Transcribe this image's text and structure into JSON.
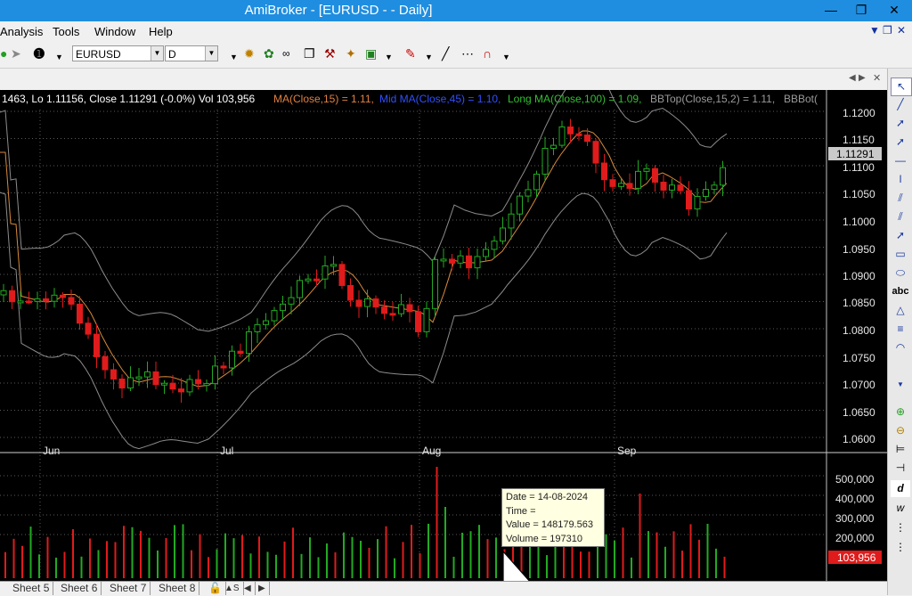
{
  "window": {
    "title": "AmiBroker - [EURUSD -  - Daily]"
  },
  "menu": [
    "Analysis",
    "Tools",
    "Window",
    "Help"
  ],
  "toolbar": {
    "symbol": "EURUSD",
    "interval": "D"
  },
  "legend": {
    "prefix": "1463, Lo 1.11156, Close 1.11291 (-0.0%) Vol 103,956",
    "ma15": "MA(Close,15) = 1.11,",
    "ma45": "Mid MA(Close,45) = 1.10,",
    "ma100": "Long MA(Close,100) = 1.09,",
    "bbtop": "BBTop(Close,15,2) = 1.11,",
    "bbbot": "BBBot("
  },
  "price_axis": {
    "ticks": [
      "1.1200",
      "1.1150",
      "1.1100",
      "1.1050",
      "1.1000",
      "1.0950",
      "1.0900",
      "1.0850",
      "1.0800",
      "1.0750",
      "1.0700",
      "1.0650",
      "1.0600"
    ],
    "last_price": "1.11291"
  },
  "time_axis": {
    "labels": [
      "Jun",
      "Jul",
      "Aug",
      "Sep"
    ]
  },
  "volume_axis": {
    "ticks": [
      "500,000",
      "400,000",
      "300,000",
      "200,000"
    ],
    "last_volume": "103,956"
  },
  "tooltip": {
    "date": "Date = 14-08-2024",
    "time": "Time =",
    "value": "Value = 148179.563",
    "volume": "Volume = 197310"
  },
  "sheets": [
    "Sheet 5",
    "Sheet 6",
    "Sheet 7",
    "Sheet 8"
  ],
  "colors": {
    "up": "#22aa22",
    "down": "#e01b1b",
    "ma": "#d88a3c",
    "band": "#8c8c8c",
    "grid": "#5a5a5a"
  }
}
